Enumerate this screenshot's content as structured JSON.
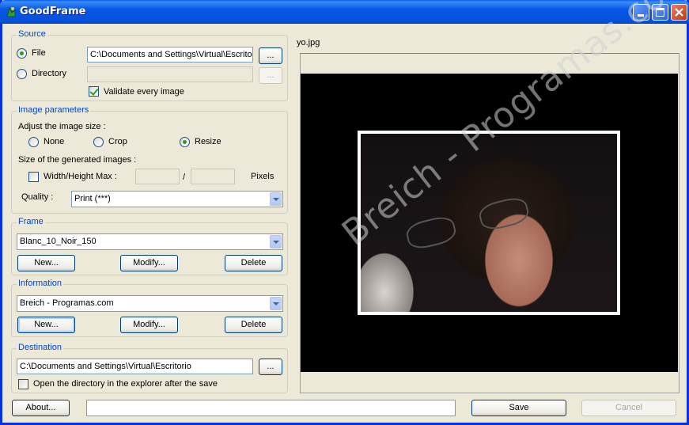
{
  "window": {
    "title": "GoodFrame"
  },
  "source": {
    "group_title": "Source",
    "file_label": "File",
    "file_selected": true,
    "file_path": "C:\\Documents and Settings\\Virtual\\Escrito",
    "directory_label": "Directory",
    "directory_path": "",
    "browse_label": "...",
    "validate_label": "Validate every image",
    "validate_checked": true
  },
  "image_params": {
    "group_title": "Image parameters",
    "adjust_label": "Adjust the image size :",
    "options": [
      "None",
      "Crop",
      "Resize"
    ],
    "selected_option": "Resize",
    "size_label": "Size of the generated images :",
    "wh_max_label": "Width/Height Max :",
    "wh_max_checked": false,
    "width_value": "",
    "height_value": "",
    "separator": "/",
    "unit_label": "Pixels",
    "quality_label": "Quality :",
    "quality_value": "Print (***)"
  },
  "frame": {
    "group_title": "Frame",
    "selected": "Blanc_10_Noir_150",
    "new_label": "New...",
    "modify_label": "Modify...",
    "delete_label": "Delete"
  },
  "information": {
    "group_title": "Information",
    "selected": "Breich - Programas.com",
    "new_label": "New...",
    "modify_label": "Modify...",
    "delete_label": "Delete"
  },
  "destination": {
    "group_title": "Destination",
    "path": "C:\\Documents and Settings\\Virtual\\Escritorio",
    "browse_label": "...",
    "open_dir_label": "Open the directory in the explorer after the save",
    "open_dir_checked": false
  },
  "preview": {
    "filename": "yo.jpg",
    "watermark": "Breich - Programas.com"
  },
  "bottom": {
    "about_label": "About...",
    "status_text": "",
    "save_label": "Save",
    "cancel_label": "Cancel"
  },
  "colors": {
    "title_bar": "#0756e6",
    "group_title": "#0046d5",
    "window_bg": "#ece9d8"
  }
}
